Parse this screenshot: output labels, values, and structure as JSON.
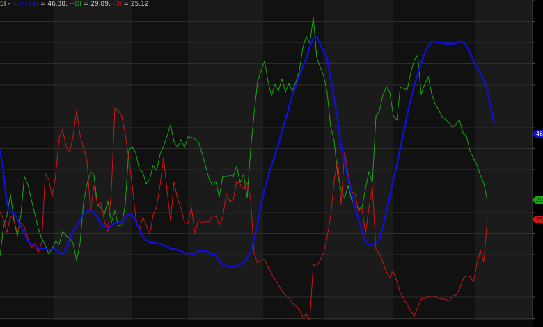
{
  "legend": {
    "prefix": "SI - ",
    "adx_label": "ADX(14)",
    "adx_eq": " = 46.38, ",
    "pdi_label": "+DI",
    "pdi_eq": " = 29.89, ",
    "mdi_label": "-DI",
    "mdi_eq": " = 25.12"
  },
  "axis_tags": {
    "adx": "46",
    "pdi": "29",
    "mdi": "25"
  },
  "colors": {
    "background": "#000000",
    "band_dark": "#111111",
    "band_light": "#1b1b1b",
    "grid": "#2e2e2e",
    "adx": "#1010d8",
    "pdi": "#16a816",
    "mdi": "#d41414"
  },
  "chart_data": {
    "type": "line",
    "title": "",
    "xlabel": "",
    "ylabel": "",
    "ylim": [
      0,
      80
    ],
    "grid": true,
    "legend_position": "top-left",
    "x": [
      0,
      5,
      10,
      15,
      20,
      25,
      30,
      35,
      40,
      45,
      50,
      55,
      60,
      65,
      70,
      75,
      80,
      85,
      90,
      95,
      100,
      105,
      110,
      115,
      120,
      125,
      130,
      135,
      140,
      145,
      150,
      155,
      160,
      165,
      170,
      175,
      180,
      185,
      190,
      195,
      200,
      205,
      210,
      215,
      220,
      225,
      230,
      235,
      240,
      245,
      250,
      255,
      260,
      265,
      270,
      275,
      280,
      285,
      290,
      295,
      300,
      305,
      310,
      315,
      320,
      325,
      330,
      335,
      340,
      345,
      350,
      355,
      360,
      365,
      370,
      375,
      380,
      385,
      390,
      395,
      400,
      405,
      410,
      415,
      420,
      425,
      430,
      435,
      440,
      445,
      450,
      455,
      460,
      465,
      470,
      475,
      480,
      485,
      490,
      495,
      500,
      505,
      510,
      515,
      520,
      525,
      530,
      535,
      540,
      545,
      550,
      555,
      560,
      565,
      570,
      575,
      580,
      585,
      590,
      595,
      600,
      605,
      610,
      615,
      620,
      625,
      630,
      635,
      640,
      645,
      650,
      655,
      660,
      665,
      670,
      675,
      680,
      685,
      690,
      695,
      700,
      705,
      710,
      715,
      720,
      725,
      730
    ],
    "series": [
      {
        "name": "ADX(14)",
        "values": [
          42.6,
          37.0,
          29.2,
          27.1,
          26.7,
          25.3,
          23.3,
          21.6,
          19.7,
          18.9,
          18.6,
          17.9,
          17.8,
          17.9,
          17.5,
          17.6,
          17.8,
          16.8,
          16.5,
          17.6,
          20.2,
          22.1,
          23.5,
          25.2,
          26.5,
          27.3,
          27.4,
          26.8,
          25.6,
          24.1,
          23.3,
          22.9,
          23.6,
          24.3,
          24.4,
          24.2,
          25.4,
          26.4,
          26.2,
          24.7,
          22.6,
          20.8,
          20.0,
          19.5,
          19.3,
          19.2,
          19.1,
          18.6,
          18.4,
          17.8,
          17.7,
          17.5,
          17.2,
          16.7,
          16.8,
          16.4,
          16.6,
          17.2,
          17.3,
          17.2,
          16.9,
          16.4,
          16.3,
          14.7,
          13.9,
          13.5,
          13.3,
          13.4,
          13.4,
          13.8,
          14.4,
          15.5,
          17.0,
          20.2,
          24.2,
          28.7,
          32.8,
          35.9,
          38.6,
          41.2,
          44.0,
          47.1,
          50.0,
          53.1,
          56.1,
          58.6,
          61.1,
          63.3,
          65.4,
          68.4,
          70.5,
          70.8,
          69.0,
          67.1,
          65.3,
          60.4,
          55.5,
          50.0,
          43.6,
          39.4,
          35.1,
          31.7,
          28.2,
          25.1,
          22.3,
          19.5,
          18.9,
          18.9,
          19.4,
          20.3,
          23.4,
          27.2,
          31.0,
          34.8,
          38.8,
          42.9,
          47.0,
          51.3,
          55.1,
          58.6,
          61.5,
          64.3,
          66.6,
          68.4,
          69.6,
          69.5,
          69.3,
          69.4,
          69.1,
          69.1,
          69.1,
          69.2,
          69.6,
          69.5,
          68.6,
          66.8,
          64.9,
          63.2,
          61.6,
          60.0,
          57.3,
          53.3,
          49.2
        ]
      },
      {
        "name": "+DI",
        "values": [
          16.0,
          23.3,
          26.2,
          31.5,
          25.0,
          20.9,
          26.4,
          35.9,
          33.9,
          30.1,
          26.5,
          22.9,
          20.3,
          18.8,
          16.5,
          17.8,
          19.8,
          18.9,
          22.2,
          21.1,
          20.4,
          19.2,
          14.8,
          19.2,
          29.5,
          34.0,
          37.0,
          36.2,
          28.7,
          28.1,
          26.6,
          29.7,
          24.3,
          27.4,
          23.5,
          23.7,
          29.1,
          42.6,
          43.3,
          41.8,
          37.6,
          37.0,
          34.1,
          35.2,
          38.7,
          37.3,
          41.5,
          43.5,
          46.0,
          48.8,
          44.6,
          43.1,
          45.1,
          43.1,
          45.8,
          45.6,
          45.2,
          44.6,
          41.8,
          38.7,
          35.5,
          33.8,
          34.6,
          30.8,
          36.0,
          35.7,
          36.3,
          35.9,
          38.5,
          34.4,
          36.4,
          30.5,
          42.6,
          51.5,
          59.7,
          62.2,
          64.8,
          59.6,
          56.1,
          58.9,
          57.2,
          60.3,
          57.0,
          59.1,
          57.2,
          59.5,
          62.3,
          68.1,
          70.9,
          69.2,
          75.7,
          65.6,
          63.2,
          61.0,
          56.8,
          48.2,
          44.8,
          36.5,
          32.4,
          30.4,
          33.6,
          30.1,
          28.6,
          27.9,
          28.1,
          32.8,
          37.1,
          34.4,
          50.9,
          52.2,
          56.2,
          58.3,
          56.9,
          51.1,
          49.9,
          58.2,
          57.9,
          57.6,
          61.8,
          64.9,
          66.2,
          56.4,
          58.9,
          60.9,
          56.6,
          54.1,
          52.6,
          50.8,
          50.2,
          49.3,
          48.1,
          49.0,
          50.0,
          46.8,
          46.0,
          42.3,
          40.5,
          38.8,
          36.2,
          34.2,
          29.9
        ]
      },
      {
        "name": "-DI",
        "values": [
          27.2,
          25.0,
          21.9,
          26.0,
          24.8,
          21.9,
          24.2,
          23.3,
          20.4,
          18.1,
          19.0,
          16.9,
          19.5,
          36.6,
          35.1,
          30.8,
          36.3,
          45.5,
          47.6,
          43.4,
          42.0,
          45.9,
          52.4,
          46.3,
          43.0,
          39.8,
          27.1,
          33.6,
          28.8,
          29.3,
          24.7,
          22.2,
          32.4,
          53.0,
          52.3,
          50.9,
          46.4,
          40.4,
          33.5,
          25.6,
          22.2,
          25.7,
          23.8,
          21.4,
          26.3,
          28.4,
          33.7,
          40.8,
          32.3,
          24.8,
          34.6,
          30.4,
          28.0,
          24.4,
          24.1,
          28.3,
          21.6,
          25.0,
          24.3,
          24.6,
          24.5,
          26.0,
          25.9,
          23.8,
          25.6,
          31.5,
          29.6,
          30.0,
          34.7,
          33.9,
          32.6,
          34.4,
          30.2,
          16.8,
          14.3,
          15.1,
          15.2,
          13.3,
          11.6,
          10.1,
          8.8,
          7.3,
          6.3,
          5.5,
          4.2,
          3.5,
          2.6,
          0.7,
          1.5,
          0.0,
          13.9,
          13.5,
          15.0,
          16.8,
          20.9,
          26.0,
          34.8,
          40.1,
          29.0,
          41.9,
          36.5,
          32.1,
          31.7,
          27.2,
          28.1,
          21.5,
          28.1,
          33.4,
          17.6,
          16.7,
          14.4,
          12.1,
          10.7,
          12.2,
          9.7,
          6.8,
          5.3,
          3.8,
          2.3,
          1.0,
          3.1,
          5.2,
          5.3,
          5.9,
          6.0,
          5.9,
          5.4,
          5.2,
          5.2,
          4.7,
          6.0,
          6.3,
          7.7,
          10.2,
          11.1,
          10.9,
          9.5,
          14.0,
          17.4,
          14.5,
          25.1
        ]
      }
    ]
  }
}
